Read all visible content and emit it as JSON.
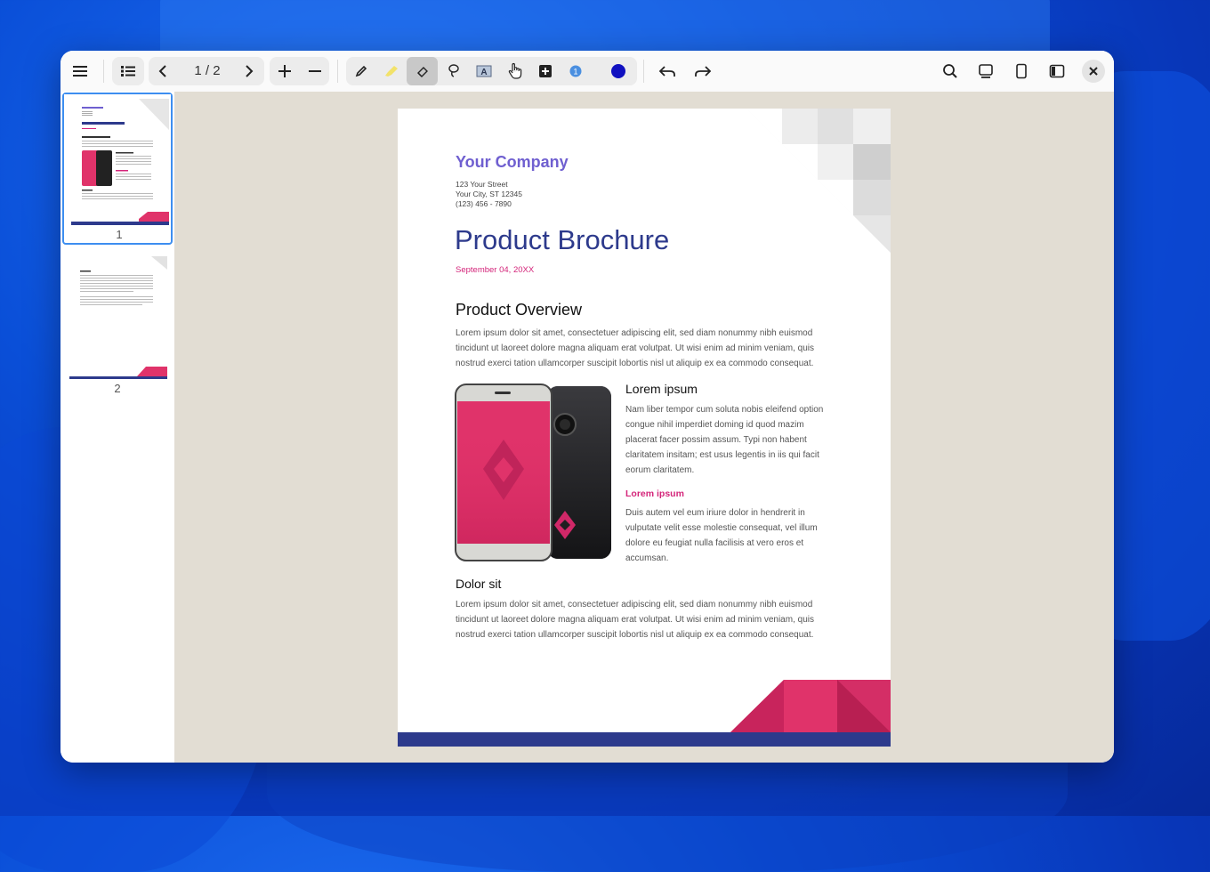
{
  "toolbar": {
    "icons": {
      "menu": "hamburger-icon",
      "thumbnails": "list-icon",
      "prev": "chevron-left-icon",
      "next": "chevron-right-icon",
      "zoom_in": "plus-icon",
      "zoom_out": "minus-icon",
      "pen": "pen-icon",
      "highlighter": "highlighter-icon",
      "eraser": "eraser-icon",
      "lasso": "lasso-icon",
      "text": "text-box-icon",
      "hand": "hand-icon",
      "add": "add-box-icon",
      "stamp": "number-badge-icon",
      "color": "color-swatch-icon",
      "undo": "undo-icon",
      "redo": "redo-icon",
      "search": "search-icon",
      "present": "monitor-icon",
      "single_page": "page-icon",
      "sidebar_toggle": "sidebar-icon",
      "close": "close-icon"
    },
    "page_indicator": "1 / 2",
    "active_tool": "eraser",
    "pen_color": "#1010c0"
  },
  "sidebar": {
    "thumbnails": [
      {
        "label": "1",
        "selected": true
      },
      {
        "label": "2",
        "selected": false
      }
    ]
  },
  "document": {
    "company": "Your Company",
    "address": [
      "123 Your Street",
      "Your City, ST 12345",
      "(123) 456 - 7890"
    ],
    "title": "Product Brochure",
    "date": "September 04, 20XX",
    "overview_heading": "Product Overview",
    "overview_lines": [
      "Lorem ipsum dolor sit amet, consectetuer adipiscing elit, sed diam nonummy nibh euismod",
      "tincidunt ut laoreet dolore magna aliquam erat volutpat. Ut wisi enim ad minim veniam, quis",
      "nostrud exerci tation ullamcorper suscipit lobortis nisl ut aliquip ex ea commodo consequat."
    ],
    "lorem_heading": "Lorem ipsum",
    "lorem_lines": [
      "Nam liber tempor cum soluta nobis eleifend option",
      "congue nihil imperdiet doming id quod mazim",
      "placerat facer possim assum. Typi non habent",
      "claritatem insitam; est usus legentis in iis qui facit",
      "eorum claritatem."
    ],
    "lorem_sub": "Lorem ipsum",
    "lorem_sub_lines": [
      "Duis autem vel eum iriure dolor in hendrerit in",
      "vulputate velit esse molestie consequat, vel illum",
      "dolore eu feugiat nulla facilisis at vero eros et",
      "accumsan."
    ],
    "dolor_heading": "Dolor sit",
    "dolor_lines": [
      "Lorem ipsum dolor sit amet, consectetuer adipiscing elit, sed diam nonummy nibh euismod",
      "tincidunt ut laoreet dolore magna aliquam erat volutpat. Ut wisi enim ad minim veniam, quis",
      "nostrud exerci tation ullamcorper suscipit lobortis nisl ut aliquip ex ea commodo consequat."
    ],
    "colors": {
      "title": "#2d3a8c",
      "company": "#6f5fd0",
      "accent": "#d4257a",
      "bar": "#2d3a8c"
    }
  }
}
